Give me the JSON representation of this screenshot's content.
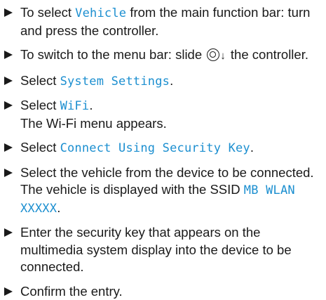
{
  "steps": [
    {
      "pre": "To select ",
      "hl": "Vehicle",
      "post": " from the main function bar: turn and press the controller."
    },
    {
      "pre": "To switch to the menu bar: slide ",
      "icon": "controller-slide-down-icon",
      "arrow": "↓",
      "post": " the controller."
    },
    {
      "pre": "Select ",
      "hl": "System Settings",
      "post": "."
    },
    {
      "pre": "Select ",
      "hl": "WiFi",
      "post": ".",
      "sub": "The Wi-Fi menu appears."
    },
    {
      "pre": "Select ",
      "hl": "Connect Using Security Key",
      "post": "."
    },
    {
      "pre": "Select the vehicle from the device to be connected. The vehicle is displayed with the SSID ",
      "hl": "MB WLAN XXXXX",
      "post": "."
    },
    {
      "pre": "Enter the security key that appears on the multimedia system display into the device to be connected."
    },
    {
      "pre": "Confirm the entry."
    }
  ],
  "colors": {
    "highlight": "#1c8fd0",
    "text": "#1a1a1a"
  }
}
